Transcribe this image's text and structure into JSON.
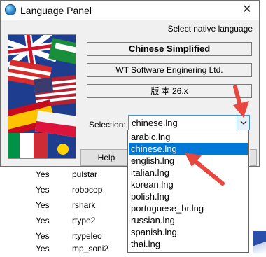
{
  "window": {
    "title": "Language Panel",
    "close_glyph": "✕"
  },
  "panel": {
    "native_label": "Select native language",
    "language_name": "Chinese Simplified",
    "author": "WT Software Enginering Ltd.",
    "version": "版 本 26.x",
    "selection_label": "Selection:",
    "selection_value": "chinese.lng",
    "help_label": "Help"
  },
  "dropdown": {
    "selected_index": 1,
    "items": [
      "arabic.lng",
      "chinese.lng",
      "english.lng",
      "italian.lng",
      "korean.lng",
      "polish.lng",
      "portuguese_br.lng",
      "russian.lng",
      "spanish.lng",
      "thai.lng"
    ]
  },
  "background_list": {
    "rows": [
      {
        "col1": "Yes",
        "col2": "pulstar"
      },
      {
        "col1": "Yes",
        "col2": "robocop"
      },
      {
        "col1": "Yes",
        "col2": "rshark"
      },
      {
        "col1": "Yes",
        "col2": "rtype2"
      },
      {
        "col1": "Yes",
        "col2": "rtypeleo"
      },
      {
        "col1": "Yes",
        "col2": "mp_soni2"
      }
    ]
  },
  "colors": {
    "selection_blue": "#0078d7",
    "annotation_red": "#e8473f"
  }
}
